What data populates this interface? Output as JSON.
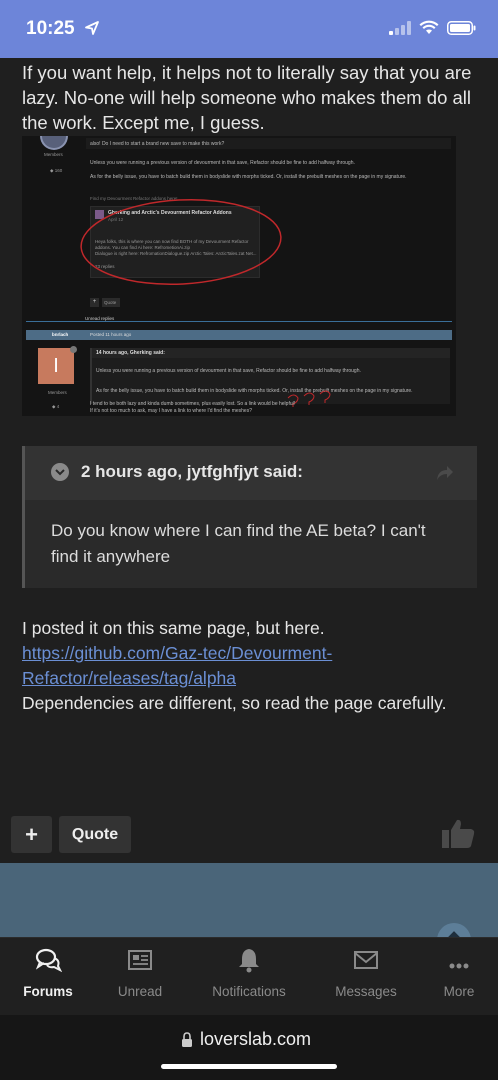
{
  "status": {
    "time": "10:25"
  },
  "post": {
    "intro": "If you want help, it helps not to literally say that you are lazy. No-one will help someone who makes them do all the work. Except me, I guess.",
    "screenshot_lines": {
      "members": "Members",
      "question": "also! Do I need to start a brand new save to make this work?",
      "line1": "Unless you were running a previous version of devourment in that save, Refactor should be fine to add halfway through.",
      "line2": "As for the belly issue, you have to batch build them in bodyslide with morphs ticked. Or, install the prebuilt meshes on the page in my signature.",
      "find_addons": "Find my Devourment Refactor addons here!",
      "card_title": "Gherking and Arctic's Devourment Refactor Addons",
      "card_date": "April 12",
      "card_body1": "Heya folks, this is where you can now find BOTH of my Devourment Refactor",
      "card_body2": "addons. You can find Ai here: RefrometionAi.zip",
      "card_body3": "Dialogue is right here: RefromationDialogue.zip Arctic Tales: ArcticTales.zat Net...",
      "card_replies": "23 replies",
      "quote_btn": "Quote",
      "unread": "Unread replies",
      "user": "bnrlach",
      "posted": "Posted 11 hours ago",
      "avatar_letter": "I",
      "inner_quote": "14 hours ago, Gherking said:",
      "reply1": "If it's not too much to ask, may I have a link to where I'd find the meshes?",
      "reply2": "I tend to be both lazy and kinda dumb sometimes, plus easily lost. So a link would be helpful!"
    },
    "quote": {
      "author_line": "2 hours ago, jytfghfjyt said:",
      "body": "Do you know where I can find the AE beta? I can't find it anywhere"
    },
    "reply_text_1": "I posted it on this same page, but here. ",
    "reply_link": "https://github.com/Gaz-tec/Devourment-Refactor/releases/tag/alpha",
    "reply_text_2": "Dependencies are different, so read the page carefully.",
    "add_label": "+",
    "quote_label": "Quote"
  },
  "nav": {
    "items": [
      {
        "label": "Forums",
        "icon": "chat-bubbles-icon",
        "active": true
      },
      {
        "label": "Unread",
        "icon": "newspaper-icon",
        "active": false
      },
      {
        "label": "Notifications",
        "icon": "bell-icon",
        "active": false
      },
      {
        "label": "Messages",
        "icon": "envelope-icon",
        "active": false
      },
      {
        "label": "More",
        "icon": "more-icon",
        "active": false
      }
    ]
  },
  "browser": {
    "url": "loverslab.com"
  },
  "colors": {
    "status_bar": "#6d85d9",
    "background": "#1f1f1f",
    "link": "#6b8fd4",
    "separator": "#4a6579",
    "annotation_red": "#c0282b"
  }
}
